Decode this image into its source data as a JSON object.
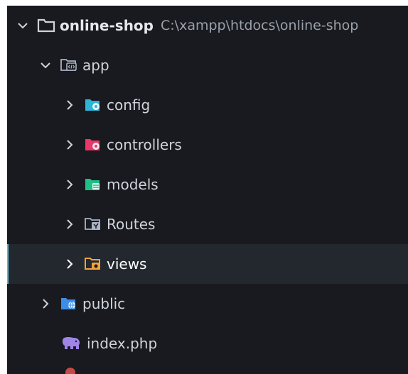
{
  "explorer": {
    "root": {
      "name": "online-shop",
      "path": "C:\\xampp\\htdocs\\online-shop"
    },
    "items": [
      {
        "label": "app",
        "icon": "folder-app-open-icon"
      },
      {
        "label": "config",
        "icon": "folder-config-icon"
      },
      {
        "label": "controllers",
        "icon": "folder-controllers-icon"
      },
      {
        "label": "models",
        "icon": "folder-models-icon"
      },
      {
        "label": "Routes",
        "icon": "folder-routes-icon"
      },
      {
        "label": "views",
        "icon": "folder-views-icon",
        "selected": true
      },
      {
        "label": "public",
        "icon": "folder-public-icon"
      },
      {
        "label": "index.php",
        "icon": "php-elephant-icon"
      }
    ]
  },
  "colors": {
    "panel_bg": "#181a1f",
    "selected_bg": "#23272e",
    "selection_accent": "#5fb8d0",
    "config_folder": "#2fb3d6",
    "controllers_folder": "#e8386b",
    "models_folder": "#1fbf88",
    "views_folder": "#f2a33c",
    "public_folder": "#3d8de8",
    "php_icon": "#a084e8"
  }
}
